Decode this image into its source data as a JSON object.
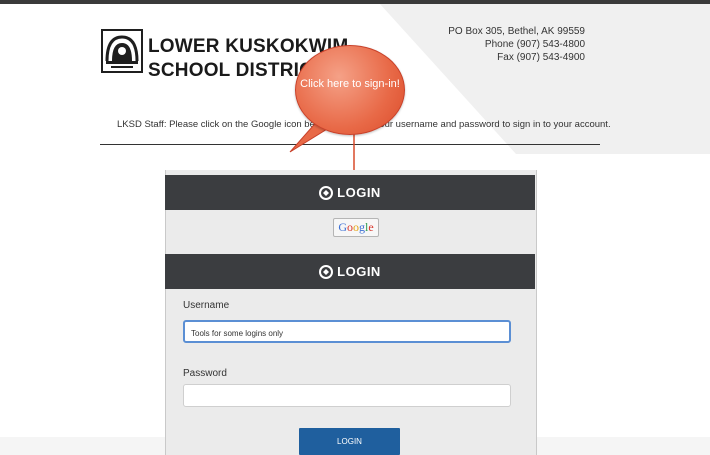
{
  "header": {
    "district_line1": "LOWER KUSKOKWIM",
    "district_line2": "SCHOOL DISTRICT",
    "address": "PO Box 305, Bethel, AK 99559",
    "phone": "Phone (907) 543-4800",
    "fax": "Fax (907) 543-4900"
  },
  "instructions": "LKSD Staff: Please click on the Google icon below and enter your username and password to sign in to your account.",
  "callout": {
    "text": "Click here to sign-in!",
    "color": "#e86947"
  },
  "panel_google": {
    "title": "LOGIN",
    "google_label": "Google"
  },
  "panel_login": {
    "title": "LOGIN",
    "username_label": "Username",
    "username_value": "Tools for some logins only",
    "password_label": "Password",
    "password_value": "",
    "login_button": "LOGIN"
  },
  "colors": {
    "header_bar": "#3b3d40",
    "login_button": "#1f5f9e",
    "input_focus": "#5b8fd4"
  }
}
